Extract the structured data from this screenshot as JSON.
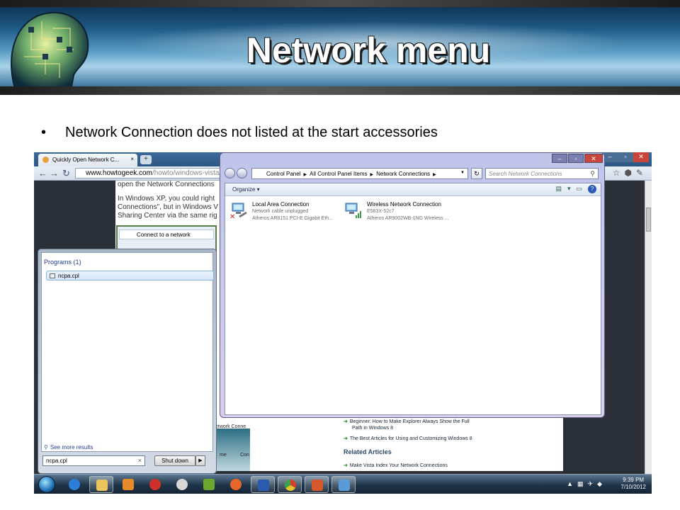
{
  "slide": {
    "title": "Network menu",
    "bullet": "Network Connection does not listed at the start accessories"
  },
  "browser": {
    "tab_title": "Quickly Open Network C...",
    "tab_close": "×",
    "new_tab": "+",
    "url_host": "www.howtogeek.com",
    "url_path": "/howto/windows-vista/",
    "article_lines": [
      "open the Network Connections",
      "In Windows XP, you could right",
      "Connections\", but in Windows V",
      "Sharing Center via the same rig"
    ],
    "menu_item": "Connect to a network",
    "fragment_network": "etwork Conne",
    "fragment_me": "me",
    "fragment_con": "Con",
    "side_links": [
      {
        "text": "Beginner: How to Make Explorer Always Show the Full",
        "text2": "Path in Windows 8"
      },
      {
        "text": "The Best Articles for Using and Customizing Windows 8",
        "text2": ""
      }
    ],
    "related_heading": "Related Articles",
    "related_link": "Make Vista Index Your Network Connections"
  },
  "start_menu": {
    "programs_header": "Programs (1)",
    "result": "ncpa.cpl",
    "see_more": "See more results",
    "search_value": "ncpa.cpl",
    "clear": "×",
    "shutdown": "Shut down",
    "shutdown_arrow": "▶"
  },
  "explorer": {
    "breadcrumb": [
      "Control Panel",
      "All Control Panel Items",
      "Network Connections"
    ],
    "search_placeholder": "Search Network Connections",
    "organize": "Organize ▾",
    "connections": [
      {
        "name": "Local Area Connection",
        "status": "Network cable unplugged",
        "adapter": "Atheros AR8151 PCI-E Gigabit Eth..."
      },
      {
        "name": "Wireless Network Connection",
        "status": "E583X-52c7",
        "adapter": "Atheros AR9002WB-1NG Wireless ..."
      }
    ]
  },
  "taskbar": {
    "time": "9:39 PM",
    "date": "7/10/2012"
  },
  "colors": {
    "title_text": "#ffffff",
    "taskbar": "#1f3448",
    "explorer_frame": "#bfc6ea",
    "link_arrow": "#3a9a2a"
  }
}
